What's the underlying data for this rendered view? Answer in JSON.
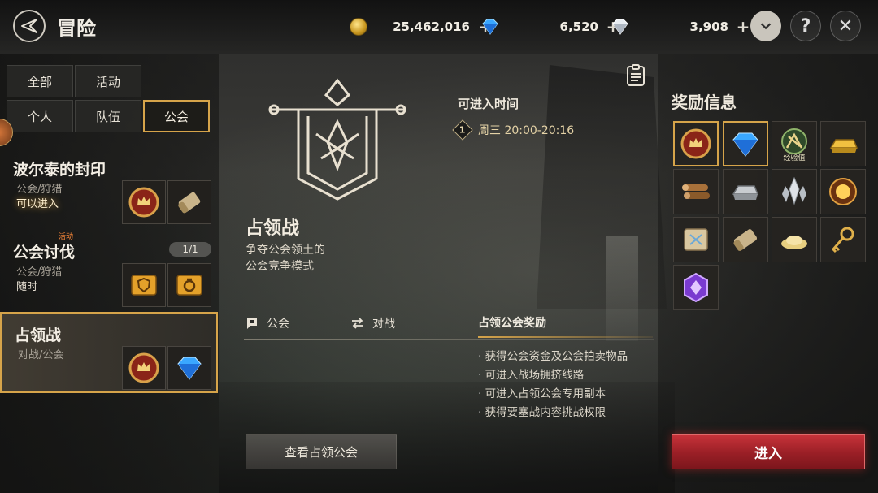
{
  "header": {
    "title": "冒险",
    "gold": "25,462,016",
    "blue_gem": "6,520",
    "white_gem": "3,908",
    "plus": "+",
    "help": "?",
    "close": "✕"
  },
  "filters": {
    "all": "全部",
    "event": "活动",
    "personal": "个人",
    "party": "队伍",
    "guild": "公会"
  },
  "dungeons": [
    {
      "name": "波尔泰的封印",
      "sub": "公会/狩猎",
      "status": "可以进入"
    },
    {
      "name": "公会讨伐",
      "sub": "公会/狩猎",
      "status": "随时",
      "count": "1/1",
      "tag": "活动"
    },
    {
      "name": "占领战",
      "sub": "对战/公会"
    }
  ],
  "detail": {
    "title": "占领战",
    "description": "争夺公会领土的\n公会竞争模式",
    "tag_guild": "公会",
    "tag_pvp": "对战",
    "time_label": "可进入时间",
    "time_index": "1",
    "time_value": "周三 20:00-20:16",
    "reward_head": "占领公会奖励",
    "rewards": [
      "获得公会资金及公会拍卖物品",
      "可进入战场拥挤线路",
      "可进入占领公会专用副本",
      "获得要塞战内容挑战权限"
    ],
    "view_button": "查看占领公会"
  },
  "reward_panel": {
    "title": "奖励信息",
    "exp_label": "经验值",
    "enter_button": "进入"
  },
  "colors": {
    "accent_gold": "#d6a44a",
    "enter_red": "#b8282f"
  }
}
